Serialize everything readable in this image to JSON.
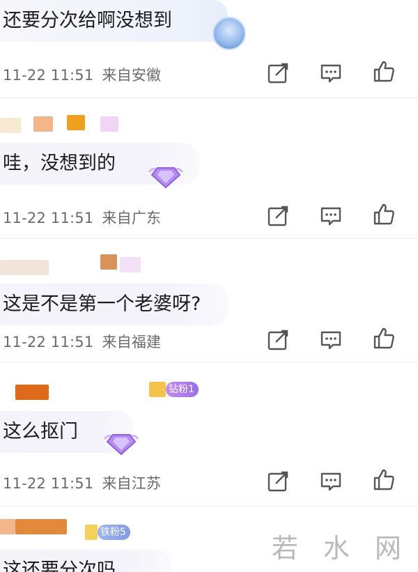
{
  "comments": [
    {
      "text": "还要分次给啊没想到",
      "time": "11-22 11:51",
      "location": "来自安徽",
      "badge": ""
    },
    {
      "text": "哇，没想到的",
      "time": "11-22 11:51",
      "location": "来自广东",
      "badge": ""
    },
    {
      "text": "这是不是第一个老婆呀?",
      "time": "11-22 11:51",
      "location": "来自福建",
      "badge": ""
    },
    {
      "text": "这么抠门",
      "time": "11-22 11:51",
      "location": "来自江苏",
      "badge": "钻粉1"
    },
    {
      "text": "这还要分次吗",
      "time": "",
      "location": "",
      "badge": "铁粉5"
    }
  ],
  "actions": {
    "share_icon": "share-icon",
    "comment_icon": "comment-icon",
    "like_icon": "like-icon"
  },
  "watermark": "若 水 网",
  "colors": {
    "badge": "#b07cec",
    "gem": "#b58cf0",
    "name_orange": "#e58a2a",
    "name_pink": "#f2c6d8"
  }
}
